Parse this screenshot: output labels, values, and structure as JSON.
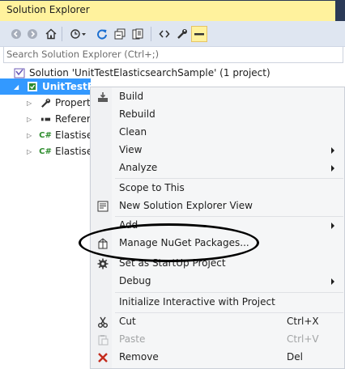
{
  "window": {
    "title": "Solution Explorer"
  },
  "toolbar": {
    "icons": [
      "back-icon",
      "forward-icon",
      "home-icon",
      "history-icon",
      "refresh-icon",
      "collapse-all-icon",
      "show-all-files-icon",
      "code-view-icon",
      "properties-wrench-icon",
      "preview-pin-icon"
    ]
  },
  "search": {
    "placeholder": "Search Solution Explorer (Ctrl+;)"
  },
  "tree": {
    "solution": "Solution 'UnitTestElasticsearchSample' (1 project)",
    "project": "UnitTestEl",
    "children": [
      {
        "label": "Propert",
        "icon": "wrench-icon"
      },
      {
        "label": "Referer",
        "icon": "references-icon"
      },
      {
        "label": "Elastise",
        "icon": "csharp-file-icon"
      },
      {
        "label": "Elastise",
        "icon": "csharp-file-icon"
      }
    ]
  },
  "context_menu": {
    "items": [
      {
        "label": "Build",
        "icon": "build-icon"
      },
      {
        "label": "Rebuild"
      },
      {
        "label": "Clean"
      },
      {
        "label": "View",
        "submenu": true
      },
      {
        "label": "Analyze",
        "submenu": true
      },
      {
        "label": "Scope to This"
      },
      {
        "label": "New Solution Explorer View",
        "icon": "new-view-icon"
      },
      {
        "label": "Add",
        "submenu": true
      },
      {
        "label": "Manage NuGet Packages...",
        "icon": "nuget-icon"
      },
      {
        "label": "Set as StartUp Project",
        "icon": "gear-icon"
      },
      {
        "label": "Debug",
        "submenu": true
      },
      {
        "label": "Initialize Interactive with Project"
      },
      {
        "label": "Cut",
        "shortcut": "Ctrl+X",
        "icon": "cut-icon"
      },
      {
        "label": "Paste",
        "shortcut": "Ctrl+V",
        "icon": "paste-icon",
        "disabled": true
      },
      {
        "label": "Remove",
        "shortcut": "Del",
        "icon": "remove-icon"
      }
    ]
  },
  "colors": {
    "title_tab": "#fff29d",
    "chrome": "#2b3a57",
    "selection": "#3399ff",
    "annotation": "#000000"
  }
}
